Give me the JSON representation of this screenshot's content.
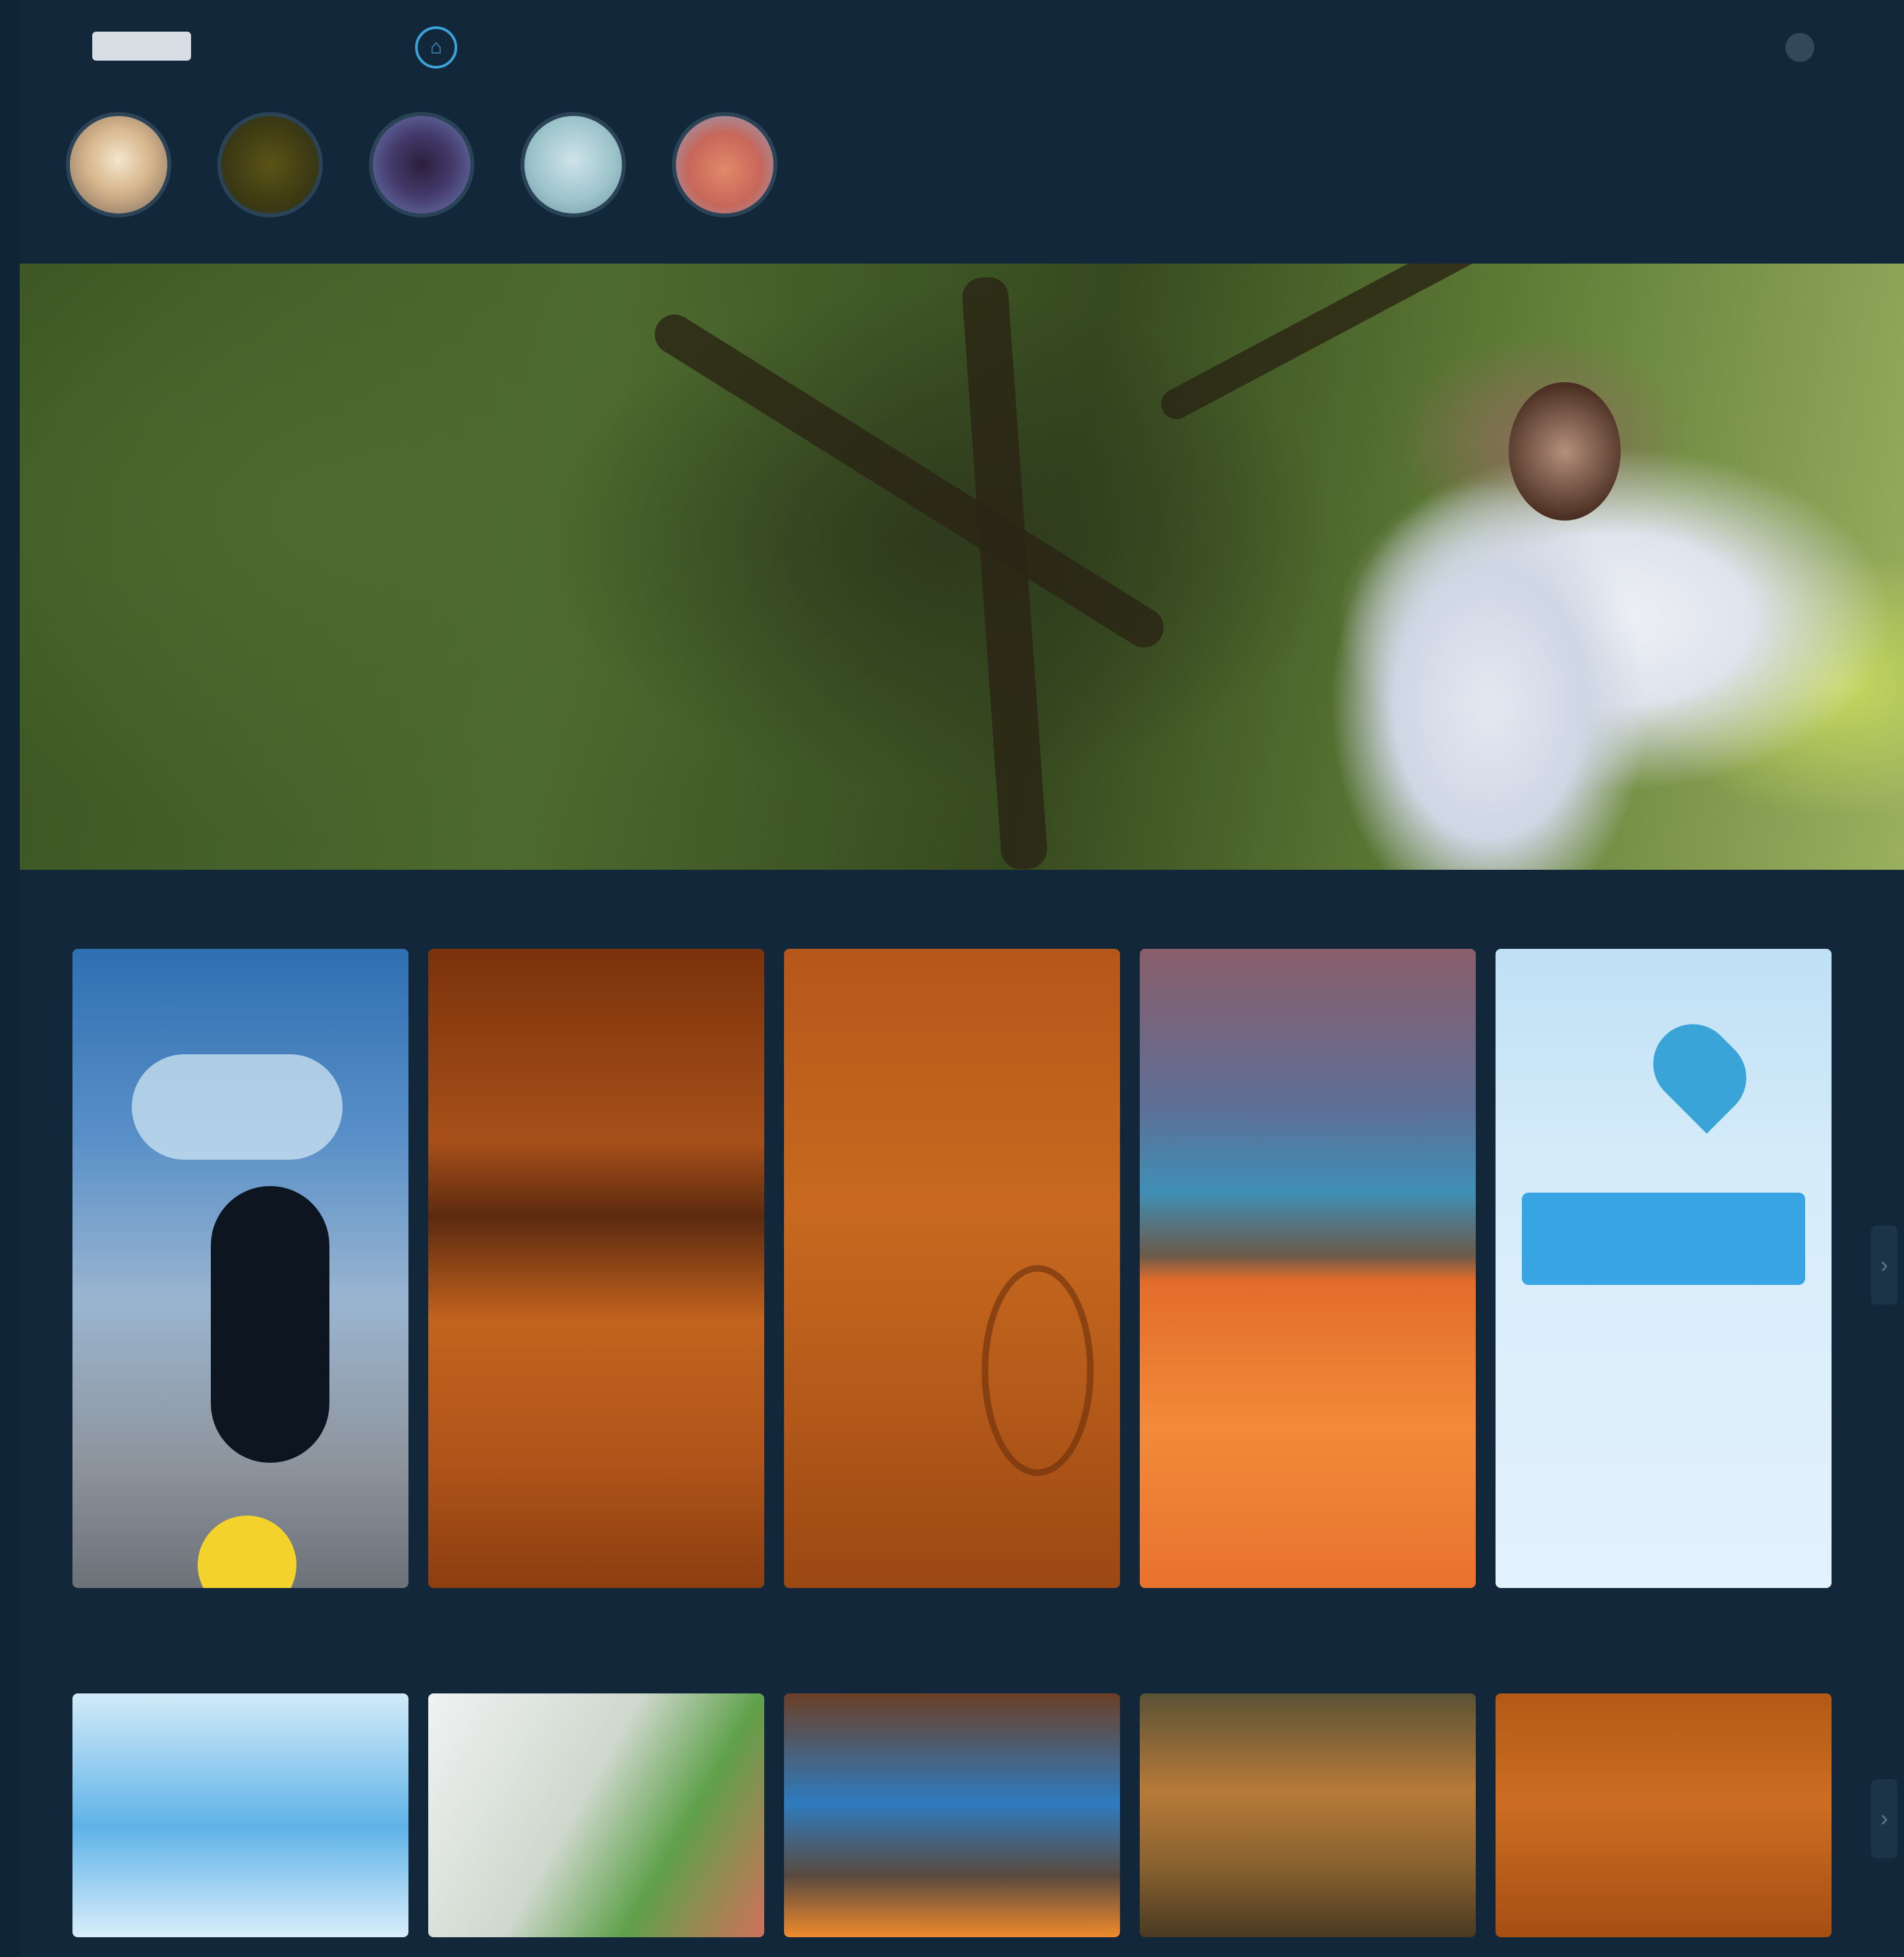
{
  "header": {
    "logo_text": "",
    "nav_links": [
      "",
      "",
      "",
      ""
    ],
    "account_label": ""
  },
  "sections": [
    {
      "title": ""
    },
    {
      "title": ""
    }
  ],
  "icons": {
    "home": "home-icon",
    "notifications": "bell-icon",
    "location": "pin-icon",
    "scroll": "chevron-right-icon"
  },
  "colors": {
    "background": "#12283a",
    "accent": "#3aa3d8"
  }
}
